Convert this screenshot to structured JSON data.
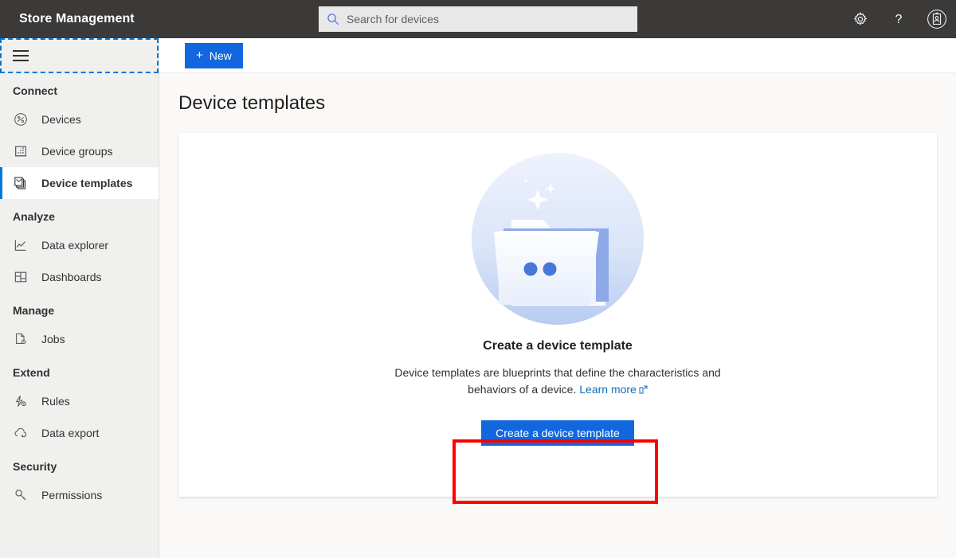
{
  "header": {
    "app_title": "Store Management",
    "search": {
      "placeholder": "Search for devices",
      "value": "",
      "icon": "search-icon"
    },
    "actions": [
      {
        "name": "settings-icon",
        "label": "Settings"
      },
      {
        "name": "help-icon",
        "label": "Help"
      },
      {
        "name": "account-badge-icon",
        "label": "Account"
      }
    ],
    "background_color": "#3b3a39"
  },
  "sidebar": {
    "menu_button": {
      "label": "Menu",
      "icon": "hamburger-icon",
      "focused": true
    },
    "groups": [
      {
        "title": "Connect",
        "items": [
          {
            "label": "Devices",
            "icon": "devices-icon",
            "selected": false
          },
          {
            "label": "Device groups",
            "icon": "device-groups-icon",
            "selected": false
          },
          {
            "label": "Device templates",
            "icon": "device-templates-icon",
            "selected": true
          }
        ]
      },
      {
        "title": "Analyze",
        "items": [
          {
            "label": "Data explorer",
            "icon": "data-explorer-icon",
            "selected": false
          },
          {
            "label": "Dashboards",
            "icon": "dashboards-icon",
            "selected": false
          }
        ]
      },
      {
        "title": "Manage",
        "items": [
          {
            "label": "Jobs",
            "icon": "jobs-icon",
            "selected": false
          }
        ]
      },
      {
        "title": "Extend",
        "items": [
          {
            "label": "Rules",
            "icon": "rules-icon",
            "selected": false
          },
          {
            "label": "Data export",
            "icon": "data-export-icon",
            "selected": false
          }
        ]
      },
      {
        "title": "Security",
        "items": [
          {
            "label": "Permissions",
            "icon": "permissions-icon",
            "selected": false
          }
        ]
      }
    ],
    "accent_color": "#0078d4",
    "background_color": "#f0f0ef"
  },
  "command_bar": {
    "new_button": {
      "label": "New",
      "icon": "plus-icon"
    }
  },
  "main": {
    "page_title": "Device templates",
    "empty_state": {
      "illustration": "folder-with-documents-illustration",
      "title": "Create a device template",
      "description_line1": "Device templates are blueprints that define the characteristics",
      "description_line2": "and behaviors of a device.",
      "learn_more_label": "Learn more",
      "learn_more_icon": "external-link-icon",
      "primary_button": "Create a device template"
    }
  },
  "annotation": {
    "target": "create-a-device-template-button",
    "color": "#ff0000"
  }
}
